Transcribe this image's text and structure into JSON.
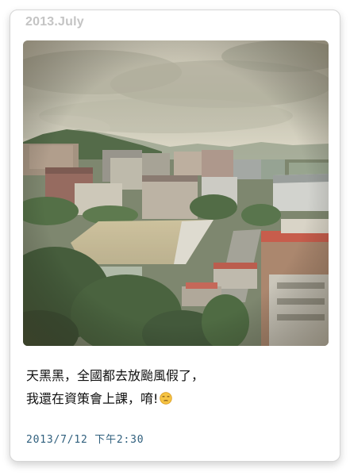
{
  "post": {
    "month_label": "2013.July",
    "caption_line1": "天黑黑，全國都去放颱風假了，",
    "caption_line2": "我還在資策會上課，唷!",
    "emoji_icon": "unamused-face-icon",
    "timestamp": "2013/7/12 下午2:30"
  },
  "photo": {
    "subject": "city-skyline-photo"
  },
  "colors": {
    "month_label": "#c4c4c4",
    "caption_text": "#111111",
    "timestamp": "#2f5f7d",
    "card_border": "#d6d6d6"
  }
}
